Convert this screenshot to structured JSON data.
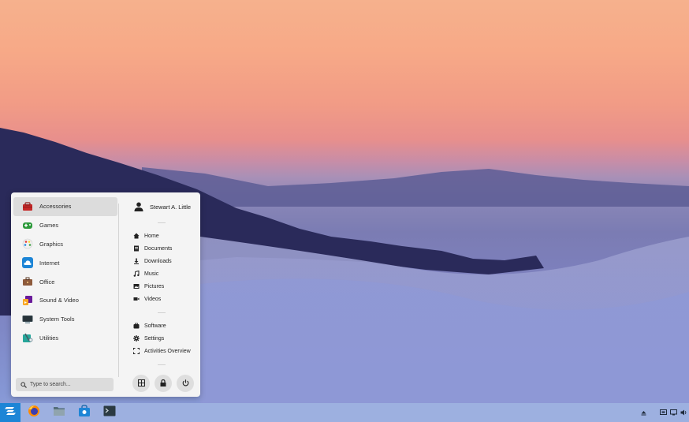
{
  "menu": {
    "categories": [
      {
        "label": "Accessories",
        "icon": "toolbox-icon"
      },
      {
        "label": "Games",
        "icon": "gamepad-icon"
      },
      {
        "label": "Graphics",
        "icon": "palette-icon"
      },
      {
        "label": "Internet",
        "icon": "cloud-icon"
      },
      {
        "label": "Office",
        "icon": "briefcase-icon"
      },
      {
        "label": "Sound & Video",
        "icon": "media-icon"
      },
      {
        "label": "System Tools",
        "icon": "monitor-icon"
      },
      {
        "label": "Utilities",
        "icon": "utilities-icon"
      }
    ],
    "selected_category": "Accessories",
    "user": {
      "name": "Stewart A. Little"
    },
    "places": [
      {
        "label": "Home",
        "icon": "home-icon"
      },
      {
        "label": "Documents",
        "icon": "document-icon"
      },
      {
        "label": "Downloads",
        "icon": "download-icon"
      },
      {
        "label": "Music",
        "icon": "music-icon"
      },
      {
        "label": "Pictures",
        "icon": "picture-icon"
      },
      {
        "label": "Videos",
        "icon": "video-icon"
      }
    ],
    "system": [
      {
        "label": "Software",
        "icon": "software-icon"
      },
      {
        "label": "Settings",
        "icon": "settings-icon"
      },
      {
        "label": "Activities Overview",
        "icon": "activities-icon"
      }
    ],
    "search": {
      "placeholder": "Type to search..."
    },
    "buttons": [
      "display-settings-icon",
      "lock-icon",
      "power-icon"
    ]
  },
  "taskbar": {
    "start": "zorin-logo-icon",
    "apps": [
      "firefox-icon",
      "files-icon",
      "software-store-icon",
      "terminal-icon"
    ],
    "tray": [
      "eject-icon",
      "screen-icon",
      "display-icon",
      "volume-icon"
    ]
  },
  "colors": {
    "accent": "#1d85d6",
    "taskbar": "#9db0e0"
  }
}
